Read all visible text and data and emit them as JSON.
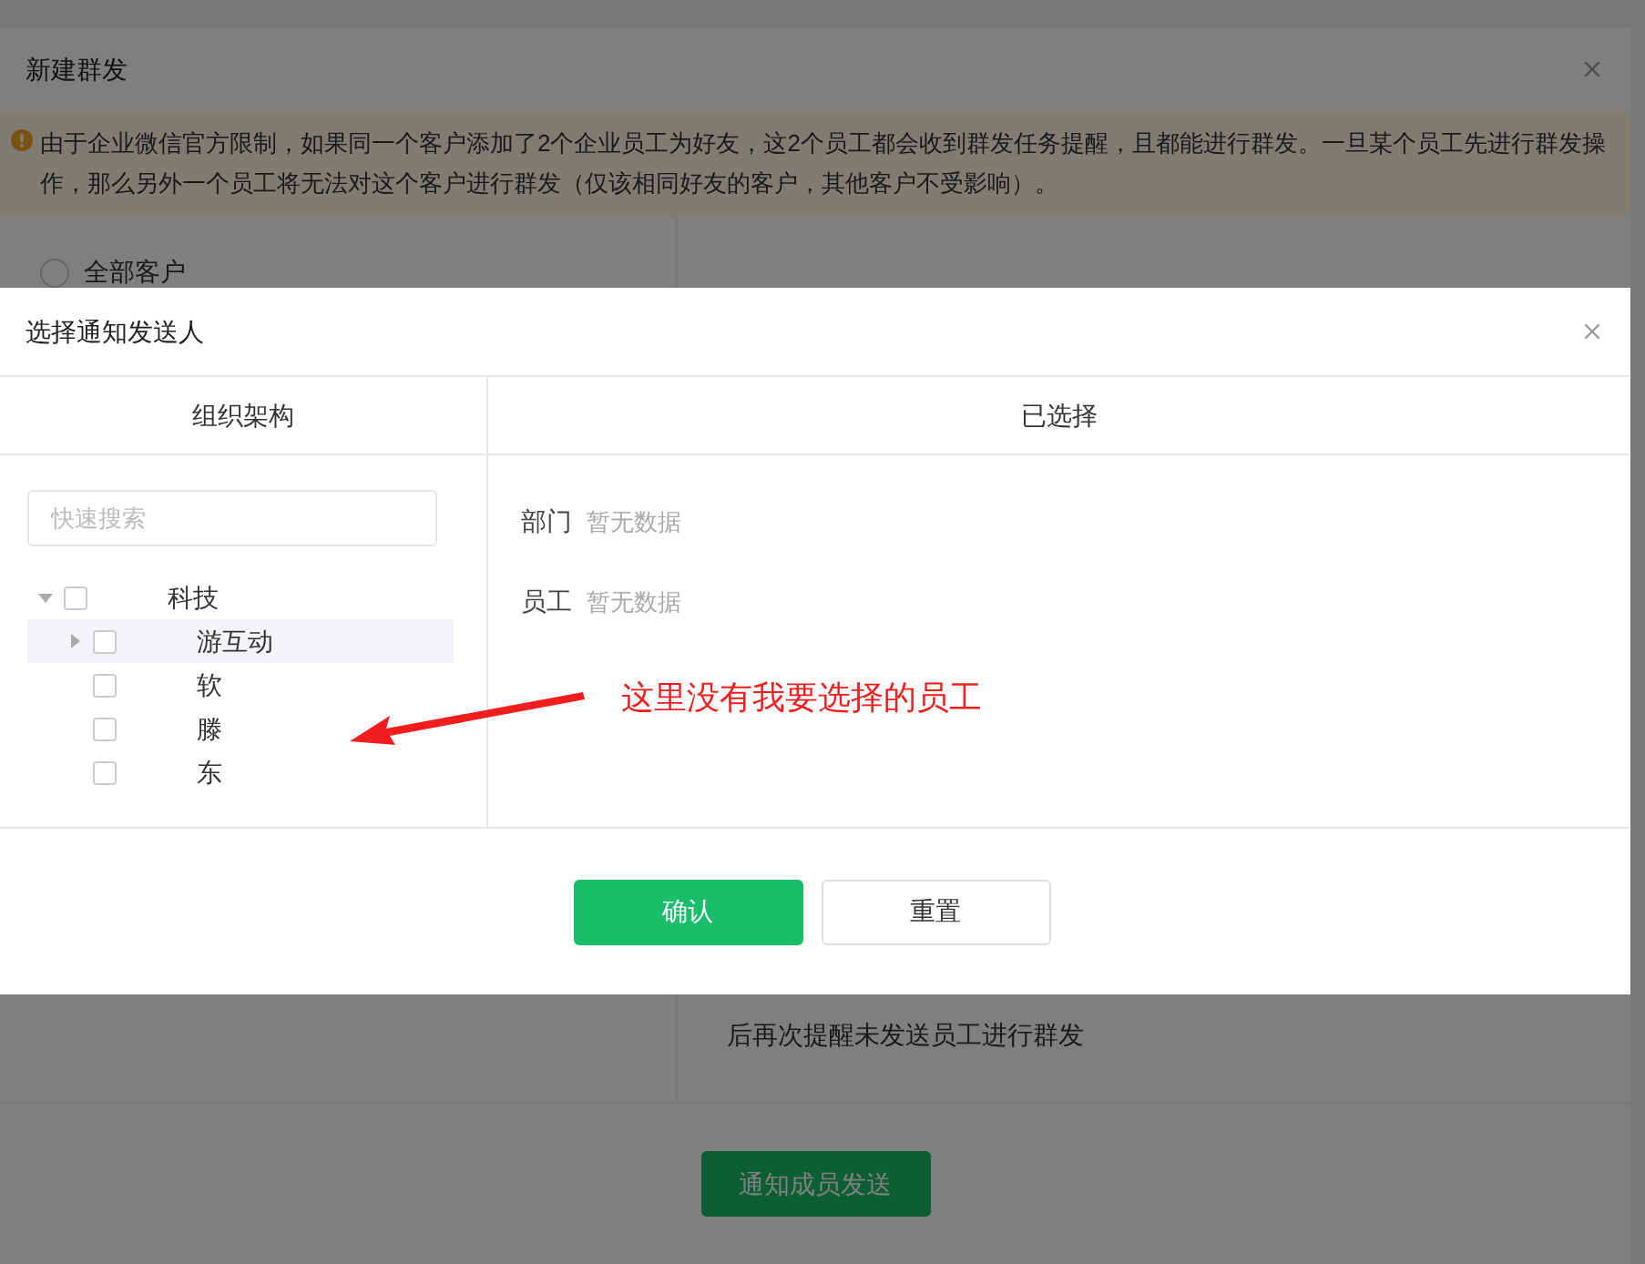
{
  "background_modal": {
    "title": "新建群发",
    "notice": "由于企业微信官方限制，如果同一个客户添加了2个企业员工为好友，这2个员工都会收到群发任务提醒，且都能进行群发。一旦某个员工先进行群发操作，那么另外一个员工将无法对这个客户进行群发（仅该相同好友的客户，其他客户不受影响）。",
    "radio": {
      "label": "全部客户",
      "selected": false
    },
    "hint": "后再次提醒未发送员工进行群发",
    "send_button": "通知成员发送"
  },
  "dialog": {
    "title": "选择通知发送人",
    "columns": [
      "组织架构",
      "已选择"
    ],
    "search": {
      "placeholder": "快速搜索"
    },
    "tree": [
      {
        "label": "科技",
        "kind": "branch",
        "expanded": true,
        "checked": false,
        "selected": false,
        "children": [
          {
            "label": "游互动",
            "kind": "branch",
            "expanded": false,
            "checked": false,
            "selected": true
          },
          {
            "label": "软",
            "kind": "leaf",
            "checked": false,
            "selected": false
          },
          {
            "label": "滕",
            "kind": "leaf",
            "checked": false,
            "selected": false
          },
          {
            "label": "东",
            "kind": "leaf",
            "checked": false,
            "selected": false
          }
        ]
      }
    ],
    "selected_groups": [
      {
        "label": "部门",
        "value": "暂无数据"
      },
      {
        "label": "员工",
        "value": "暂无数据"
      }
    ],
    "buttons": [
      {
        "label": "确认",
        "kind": "primary"
      },
      {
        "label": "重置",
        "kind": "default"
      }
    ]
  },
  "annotation": {
    "text": "这里没有我要选择的员工"
  }
}
